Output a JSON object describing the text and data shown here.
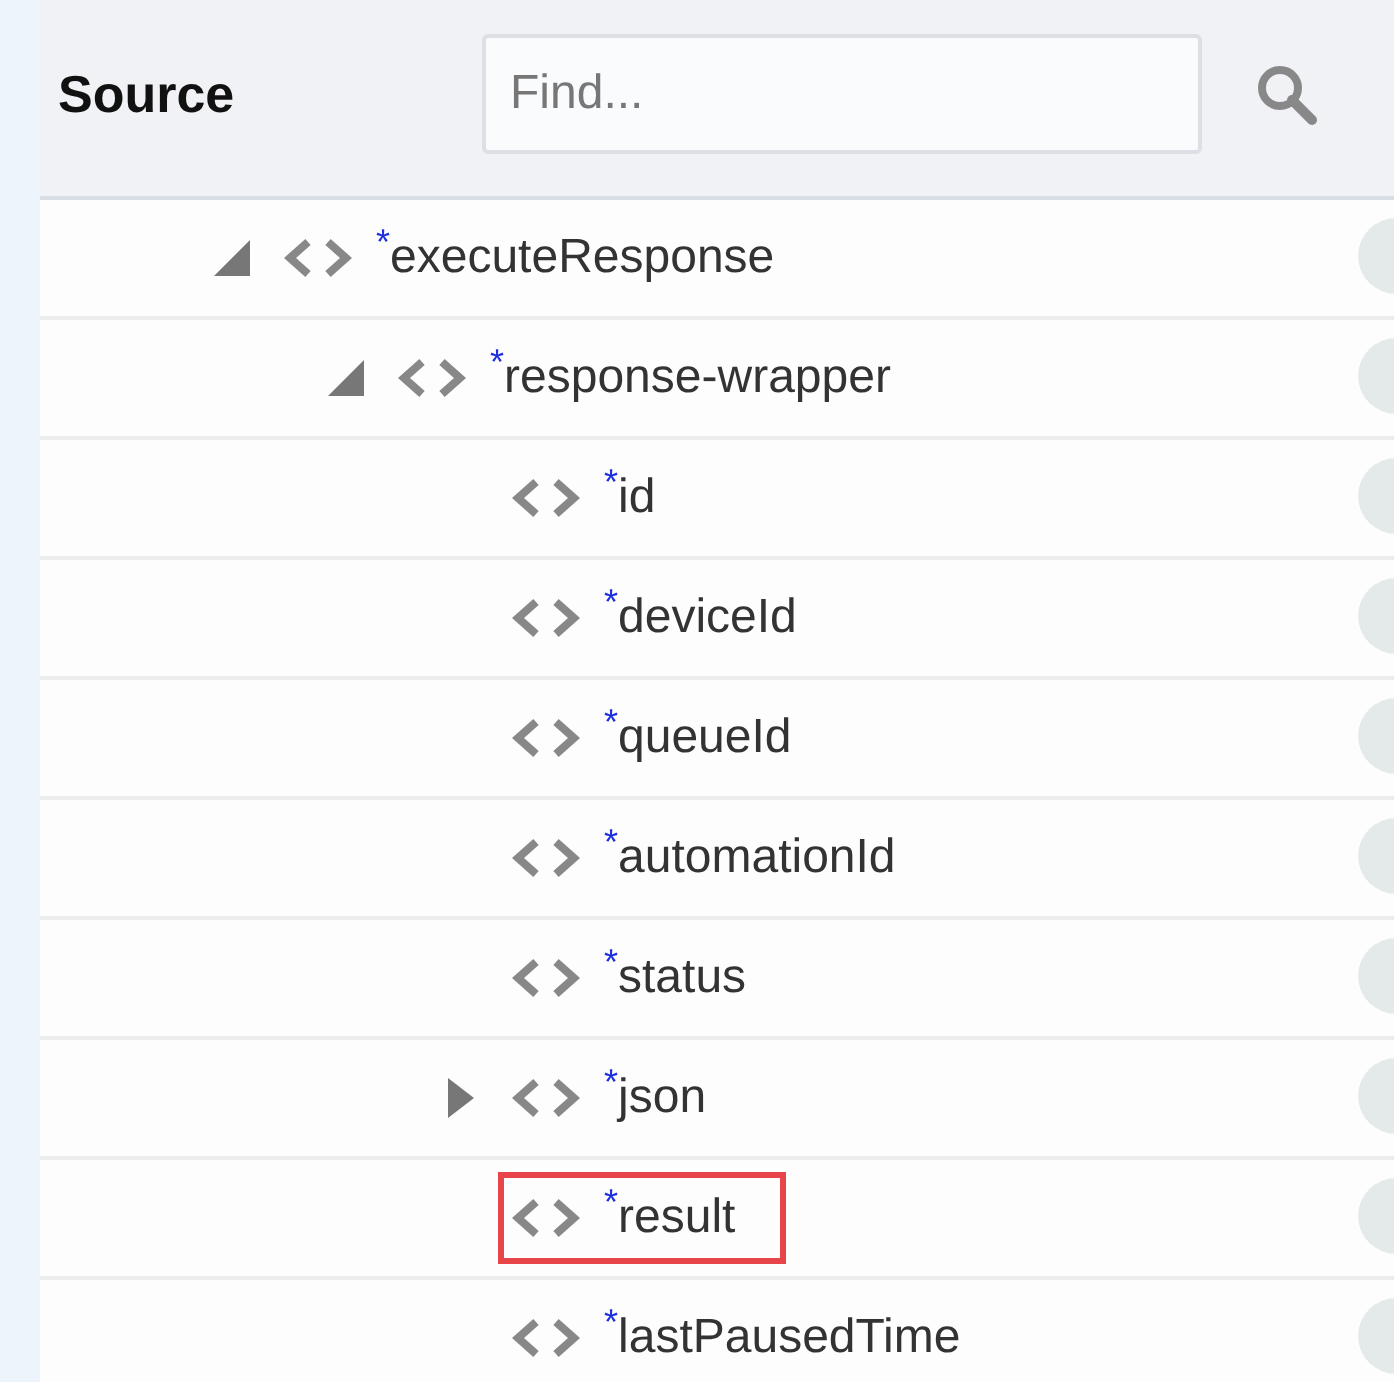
{
  "header": {
    "title": "Source",
    "search": {
      "placeholder": "Find..."
    }
  },
  "tree": [
    {
      "kind": "group",
      "name": "executeResponse",
      "marker": "*",
      "expanded": true,
      "highlighted": false,
      "children": [
        {
          "kind": "group",
          "name": "response-wrapper",
          "marker": "*",
          "expanded": true,
          "highlighted": false,
          "children": [
            {
              "kind": "leaf",
              "name": "id",
              "marker": "*",
              "highlighted": false
            },
            {
              "kind": "leaf",
              "name": "deviceId",
              "marker": "*",
              "highlighted": false
            },
            {
              "kind": "leaf",
              "name": "queueId",
              "marker": "*",
              "highlighted": false
            },
            {
              "kind": "leaf",
              "name": "automationId",
              "marker": "*",
              "highlighted": false
            },
            {
              "kind": "leaf",
              "name": "status",
              "marker": "*",
              "highlighted": false
            },
            {
              "kind": "group",
              "name": "json",
              "marker": "*",
              "expanded": false,
              "highlighted": false
            },
            {
              "kind": "leaf",
              "name": "result",
              "marker": "*",
              "highlighted": true
            },
            {
              "kind": "leaf",
              "name": "lastPausedTime",
              "marker": "*",
              "highlighted": false
            }
          ]
        }
      ]
    }
  ]
}
